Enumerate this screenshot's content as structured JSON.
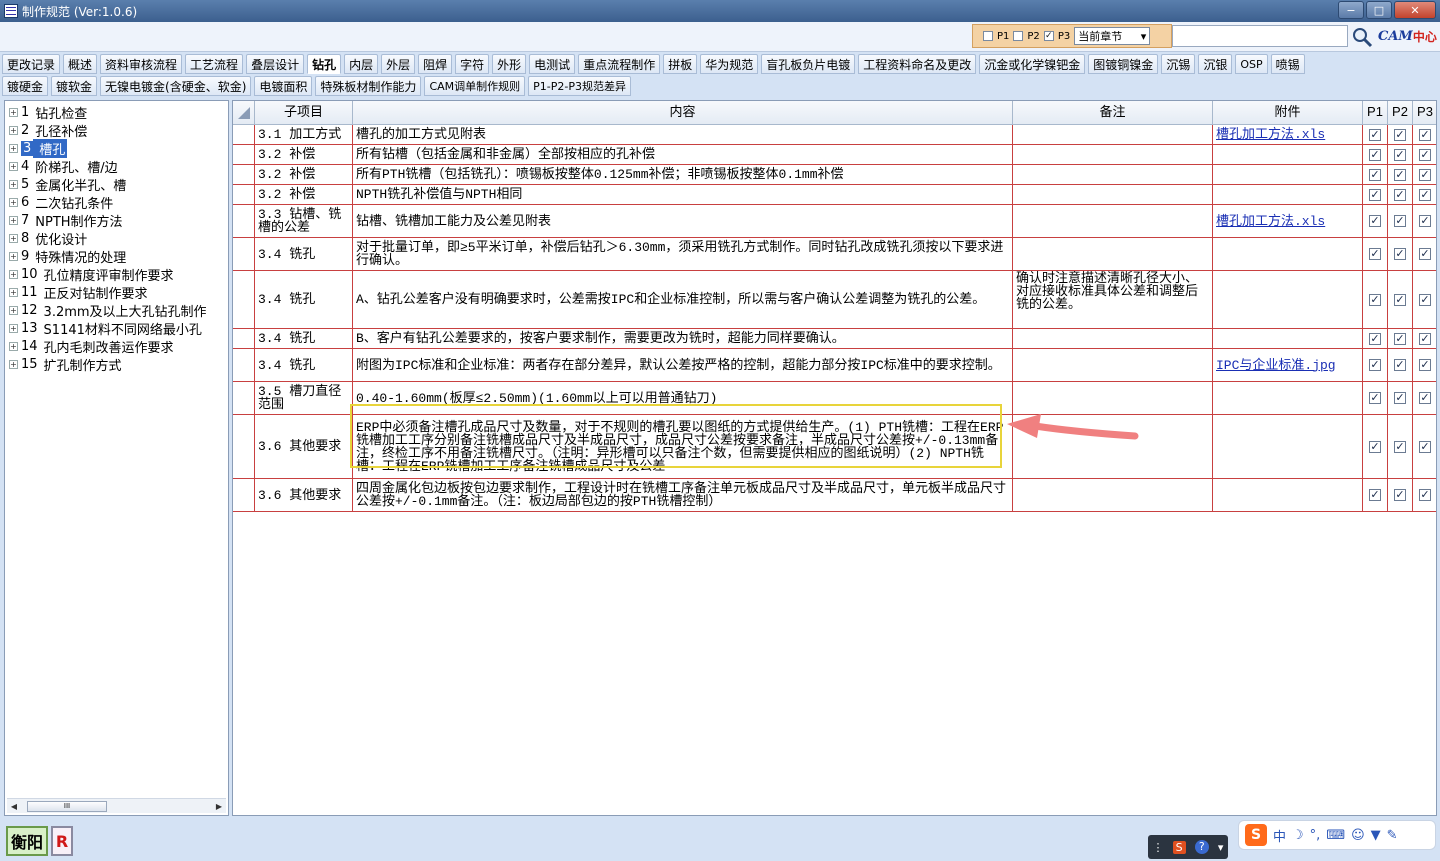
{
  "window": {
    "title": "制作规范 (Ver:1.0.6)",
    "minimize": "−",
    "maximize": "□",
    "close": "✕"
  },
  "filters": {
    "p1": "P1",
    "p2": "P2",
    "p3": "P3",
    "p3_checked": true,
    "chapter": "当前章节"
  },
  "logo": {
    "text": "CAM",
    "accent": "中心"
  },
  "tabs_row1": [
    "更改记录",
    "概述",
    "资料审核流程",
    "工艺流程",
    "叠层设计",
    "钻孔",
    "内层",
    "外层",
    "阻焊",
    "字符",
    "外形",
    "电测试",
    "重点流程制作",
    "拼板",
    "华为规范",
    "盲孔板负片电镀",
    "工程资料命名及更改",
    "沉金或化学镍钯金",
    "图镀铜镍金",
    "沉锡",
    "沉银",
    "OSP",
    "喷锡"
  ],
  "tabs_row1_active": "钻孔",
  "tabs_row2": [
    "镀硬金",
    "镀软金",
    "无镍电镀金(含硬金、软金)",
    "电镀面积",
    "特殊板材制作能力",
    "CAM调单制作规则",
    "P1-P2-P3规范差异"
  ],
  "tree": [
    {
      "num": "1",
      "label": "钻孔检查"
    },
    {
      "num": "2",
      "label": "孔径补偿"
    },
    {
      "num": "3",
      "label": "槽孔",
      "selected": true
    },
    {
      "num": "4",
      "label": "阶梯孔、槽/边"
    },
    {
      "num": "5",
      "label": "金属化半孔、槽"
    },
    {
      "num": "6",
      "label": "二次钻孔条件"
    },
    {
      "num": "7",
      "label": "NPTH制作方法"
    },
    {
      "num": "8",
      "label": "优化设计"
    },
    {
      "num": "9",
      "label": "特殊情况的处理"
    },
    {
      "num": "10",
      "label": "孔位精度评审制作要求"
    },
    {
      "num": "11",
      "label": "正反对钻制作要求"
    },
    {
      "num": "12",
      "label": "3.2mm及以上大孔钻孔制作"
    },
    {
      "num": "13",
      "label": "S1141材料不同网络最小孔"
    },
    {
      "num": "14",
      "label": "孔内毛刺改善运作要求"
    },
    {
      "num": "15",
      "label": "扩孔制作方式"
    }
  ],
  "grid": {
    "headers": {
      "sub": "子项目",
      "content": "内容",
      "note": "备注",
      "attach": "附件",
      "p1": "P1",
      "p2": "P2",
      "p3": "P3"
    },
    "rows": [
      {
        "sub": "3.1 加工方式",
        "content": "槽孔的加工方式见附表",
        "note": "",
        "attach": "槽孔加工方法.xls"
      },
      {
        "sub": "3.2 补偿",
        "content": "所有钻槽（包括金属和非金属）全部按相应的孔补偿",
        "note": "",
        "attach": ""
      },
      {
        "sub": "3.2 补偿",
        "content": "所有PTH铣槽（包括铣孔）：喷锡板按整体0.125mm补偿；非喷锡板按整体0.1mm补偿",
        "note": "",
        "attach": ""
      },
      {
        "sub": "3.2 补偿",
        "content": "NPTH铣孔补偿值与NPTH相同",
        "note": "",
        "attach": ""
      },
      {
        "sub": "3.3 钻槽、铣槽的公差",
        "content": "钻槽、铣槽加工能力及公差见附表",
        "note": "",
        "attach": "槽孔加工方法.xls"
      },
      {
        "sub": "3.4 铣孔",
        "content": "对于批量订单，即≥5平米订单，补偿后钻孔＞6.30mm，须采用铣孔方式制作。同时钻孔改成铣孔须按以下要求进行确认。",
        "note": "",
        "attach": ""
      },
      {
        "sub": "3.4 铣孔",
        "content": "A、钻孔公差客户没有明确要求时，公差需按IPC和企业标准控制，所以需与客户确认公差调整为铣孔的公差。",
        "note": "确认时注意描述清晰孔径大小、对应接收标准具体公差和调整后铣的公差。",
        "attach": ""
      },
      {
        "sub": "3.4 铣孔",
        "content": "B、客户有钻孔公差要求的，按客户要求制作，需要更改为铣时，超能力同样要确认。",
        "note": "",
        "attach": ""
      },
      {
        "sub": "3.4 铣孔",
        "content": "附图为IPC标准和企业标准：两者存在部分差异，默认公差按严格的控制，超能力部分按IPC标准中的要求控制。",
        "note": "",
        "attach": "IPC与企业标准.jpg"
      },
      {
        "sub": "3.5 槽刀直径范围",
        "content": "0.40-1.60mm(板厚≤2.50mm)(1.60mm以上可以用普通钻刀)",
        "note": "",
        "attach": ""
      },
      {
        "sub": "3.6 其他要求",
        "content": "ERP中必须备注槽孔成品尺寸及数量，对于不规则的槽孔要以图纸的方式提供给生产。(1) PTH铣槽：工程在ERP铣槽加工工序分别备注铣槽成品尺寸及半成品尺寸，成品尺寸公差按要求备注，半成品尺寸公差按+/-0.13mm备注，终检工序不用备注铣槽尺寸。（注明：异形槽可以只备注个数，但需要提供相应的图纸说明）(2) NPTH铣槽：工程在ERP铣槽加工工序备注铣槽成品尺寸及公差",
        "note": "",
        "attach": ""
      },
      {
        "sub": "3.6 其他要求",
        "content": "四周金属化包边板按包边要求制作，工程设计时在铣槽工序备注单元板成品尺寸及半成品尺寸，单元板半成品尺寸公差按+/-0.1mm备注。（注：板边局部包边的按PTH铣槽控制）",
        "note": "",
        "attach": ""
      }
    ]
  },
  "status": {
    "company": "衡阳",
    "r_label": "R"
  },
  "tray": {
    "s": "S",
    "help": "?"
  },
  "ime": {
    "s": "S",
    "lang": "中"
  },
  "colors": {
    "grid_line": "#c84040",
    "highlight": "#e8d43a",
    "arrow": "#f08080",
    "link": "#1a2fb4",
    "selected": "#3169c6"
  }
}
